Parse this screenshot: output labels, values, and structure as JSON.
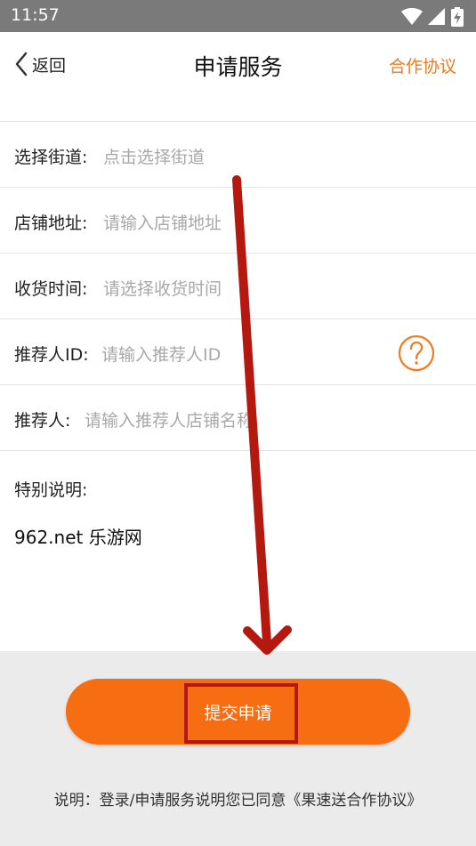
{
  "status_bar": {
    "time": "11:57",
    "icons": [
      "wifi-icon",
      "cell-signal-icon",
      "battery-charging-icon"
    ]
  },
  "navbar": {
    "back_label": "返回",
    "title": "申请服务",
    "agreement_link": "合作协议"
  },
  "form": {
    "fields": [
      {
        "label": "选择街道:",
        "placeholder": "点击选择街道"
      },
      {
        "label": "店铺地址:",
        "placeholder": "请输入店铺地址"
      },
      {
        "label": "收货时间:",
        "placeholder": "请选择收货时间"
      },
      {
        "label": "推荐人ID:",
        "placeholder": "请输入推荐人ID"
      },
      {
        "label": "推荐人:",
        "placeholder": "请输入推荐人店铺名称"
      }
    ],
    "special_label": "特别说明:",
    "special_text": "962.net 乐游网"
  },
  "bottom": {
    "submit_label": "提交申请",
    "note": "说明：登录/申请服务说明您已同意《果速送合作协议》"
  },
  "colors": {
    "accent": "#f76d12",
    "link": "#f07a1c",
    "annotation": "#b5180f",
    "status_bar": "#7a7a7a"
  }
}
